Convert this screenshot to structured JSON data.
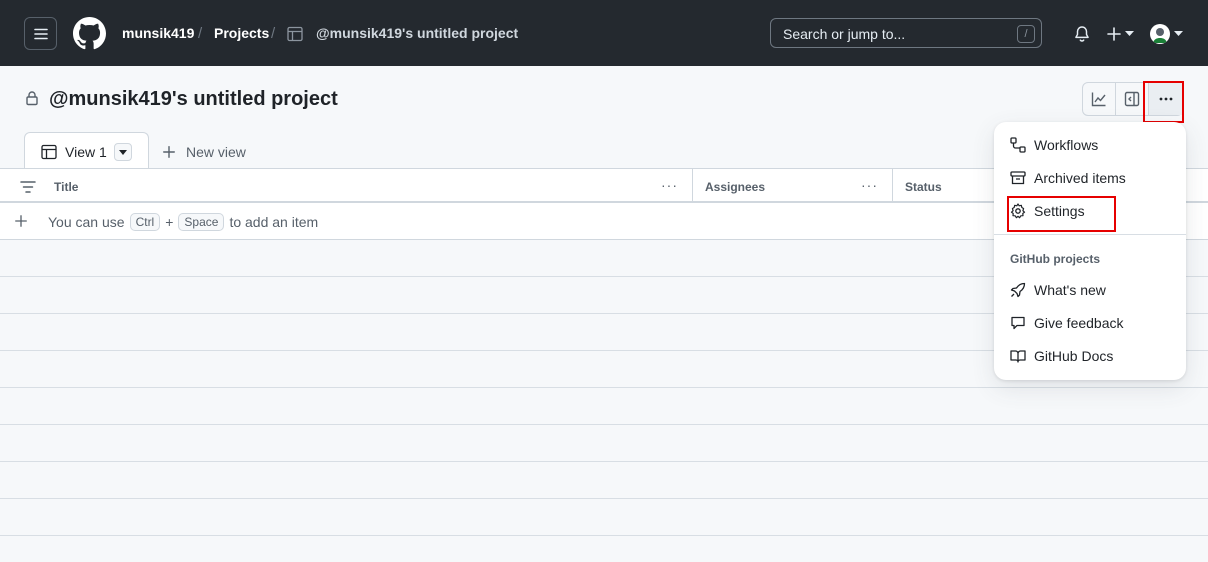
{
  "header": {
    "user": "munsik419",
    "projects": "Projects",
    "project_name": "@munsik419's untitled project",
    "search_placeholder": "Search or jump to...",
    "search_key": "/",
    "plus_label": "+"
  },
  "page": {
    "title": "@munsik419's untitled project"
  },
  "tabs": {
    "active_label": "View 1",
    "new_view_label": "New view"
  },
  "table": {
    "columns": [
      "Title",
      "Assignees",
      "Status"
    ],
    "add_prefix": "You can use",
    "add_key1": "Ctrl",
    "add_plus": "+",
    "add_key2": "Space",
    "add_suffix": "to add an item"
  },
  "menu": {
    "items": [
      {
        "label": "Workflows",
        "icon": "workflow-icon"
      },
      {
        "label": "Archived items",
        "icon": "archive-icon"
      },
      {
        "label": "Settings",
        "icon": "gear-icon"
      }
    ],
    "group_label": "GitHub projects",
    "group_items": [
      {
        "label": "What's new",
        "icon": "rocket-icon"
      },
      {
        "label": "Give feedback",
        "icon": "comment-icon"
      },
      {
        "label": "GitHub Docs",
        "icon": "book-icon"
      }
    ]
  },
  "colors": {
    "header_bg": "#24292f",
    "highlight": "#e60000"
  }
}
